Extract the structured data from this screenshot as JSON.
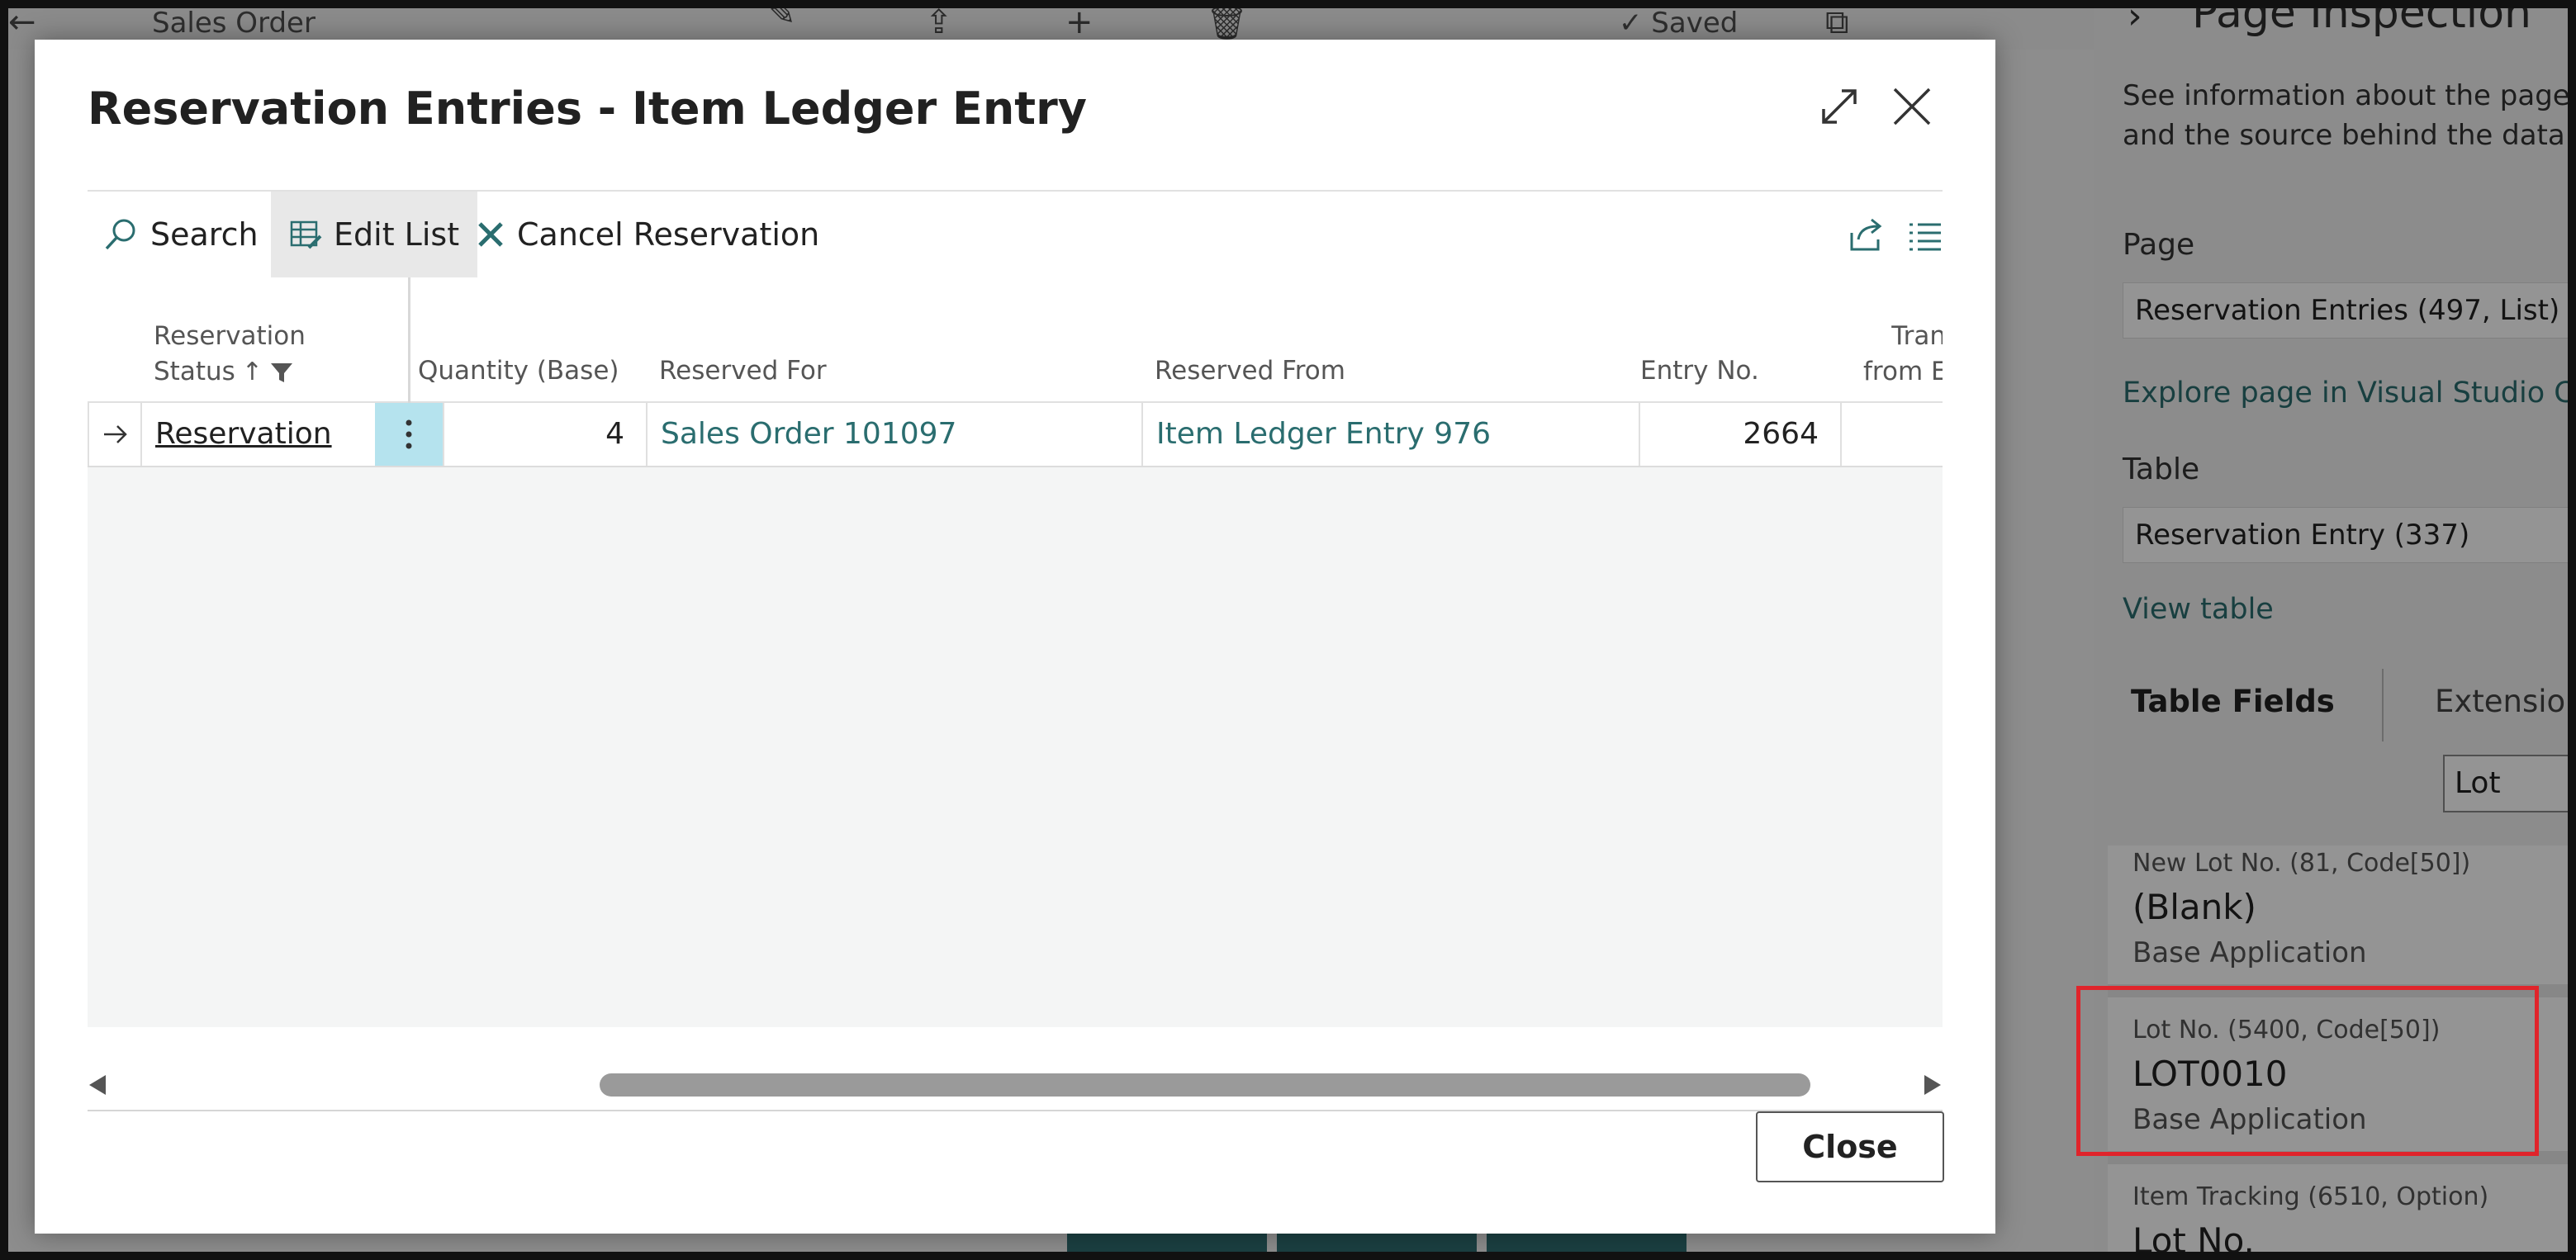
{
  "background": {
    "title": "Sales Order",
    "saved_label": "Saved"
  },
  "dialog": {
    "title": "Reservation Entries - Item Ledger Entry",
    "actions": {
      "search": "Search",
      "edit_list": "Edit List",
      "cancel_reservation": "Cancel Reservation"
    },
    "columns": {
      "reservation_status": [
        "Reservation",
        "Status"
      ],
      "quantity_base": "Quantity (Base)",
      "reserved_for": "Reserved For",
      "reserved_from": "Reserved From",
      "entry_no": "Entry No.",
      "transferred_from_entry": [
        "Tran",
        "from En"
      ]
    },
    "rows": [
      {
        "reservation_status": "Reservation",
        "quantity_base": "4",
        "reserved_for": "Sales Order 101097",
        "reserved_from": "Item Ledger Entry 976",
        "entry_no": "2664"
      }
    ],
    "close_label": "Close"
  },
  "inspection": {
    "title": "Page Inspection",
    "description": "See information about the page, i and the source behind the data it",
    "page_label": "Page",
    "page_value": "Reservation Entries (497, List)",
    "explore_link": "Explore page in Visual Studio Co",
    "table_label": "Table",
    "table_value": "Reservation Entry (337)",
    "view_table_link": "View table",
    "tabs": {
      "table_fields": "Table Fields",
      "extensions": "Extensions"
    },
    "filter_value": "Lot",
    "fields": [
      {
        "name": "New Lot No. (81, Code[50])",
        "value": "(Blank)",
        "source": "Base Application"
      },
      {
        "name": "Lot No. (5400, Code[50])",
        "value": "LOT0010",
        "source": "Base Application"
      },
      {
        "name": "Item Tracking (6510, Option)",
        "value": "Lot No.",
        "source": ""
      }
    ],
    "highlight_color": "#e0242b"
  }
}
